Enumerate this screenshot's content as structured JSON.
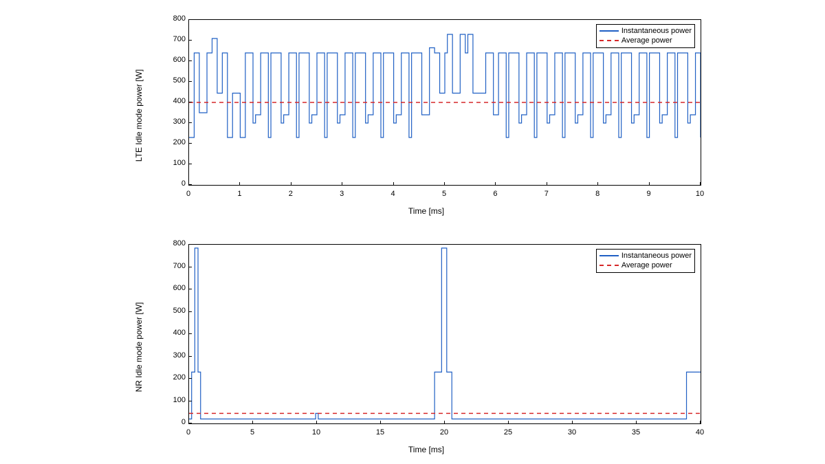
{
  "chart_data": [
    {
      "type": "line",
      "title": "",
      "xlabel": "Time [ms]",
      "ylabel": "LTE Idle mode power [W]",
      "xlim": [
        0,
        10
      ],
      "ylim": [
        0,
        800
      ],
      "xticks": [
        0,
        1,
        2,
        3,
        4,
        5,
        6,
        7,
        8,
        9,
        10
      ],
      "yticks": [
        0,
        100,
        200,
        300,
        400,
        500,
        600,
        700,
        800
      ],
      "legend": {
        "position": "upper-right",
        "entries": [
          "Instantaneous power",
          "Average power"
        ]
      },
      "average": 400,
      "note": "Instantaneous power toggles between ~230 W (low) and ~640 W (high) on ~0.25 ms slots; sporadic peaks ~710–730 W and mid-level ~445 W segments.",
      "series": [
        {
          "name": "Instantaneous power",
          "kind": "step",
          "segments_x_y": [
            [
              0.0,
              230
            ],
            [
              0.1,
              230
            ],
            [
              0.1,
              640
            ],
            [
              0.2,
              640
            ],
            [
              0.2,
              350
            ],
            [
              0.35,
              350
            ],
            [
              0.35,
              640
            ],
            [
              0.45,
              640
            ],
            [
              0.45,
              710
            ],
            [
              0.55,
              710
            ],
            [
              0.55,
              445
            ],
            [
              0.65,
              445
            ],
            [
              0.65,
              640
            ],
            [
              0.75,
              640
            ],
            [
              0.75,
              230
            ],
            [
              0.85,
              230
            ],
            [
              0.85,
              445
            ],
            [
              1.0,
              445
            ],
            [
              1.0,
              230
            ],
            [
              1.1,
              230
            ],
            [
              1.1,
              640
            ],
            [
              1.25,
              640
            ],
            [
              1.25,
              300
            ],
            [
              1.3,
              300
            ],
            [
              1.3,
              340
            ],
            [
              1.4,
              340
            ],
            [
              1.4,
              640
            ],
            [
              1.55,
              640
            ],
            [
              1.55,
              230
            ],
            [
              1.6,
              230
            ],
            [
              1.6,
              640
            ],
            [
              1.8,
              640
            ],
            [
              1.8,
              300
            ],
            [
              1.85,
              300
            ],
            [
              1.85,
              340
            ],
            [
              1.95,
              340
            ],
            [
              1.95,
              640
            ],
            [
              2.1,
              640
            ],
            [
              2.1,
              230
            ],
            [
              2.15,
              230
            ],
            [
              2.15,
              640
            ],
            [
              2.35,
              640
            ],
            [
              2.35,
              300
            ],
            [
              2.4,
              300
            ],
            [
              2.4,
              340
            ],
            [
              2.5,
              340
            ],
            [
              2.5,
              640
            ],
            [
              2.65,
              640
            ],
            [
              2.65,
              230
            ],
            [
              2.7,
              230
            ],
            [
              2.7,
              640
            ],
            [
              2.9,
              640
            ],
            [
              2.9,
              300
            ],
            [
              2.95,
              300
            ],
            [
              2.95,
              340
            ],
            [
              3.05,
              340
            ],
            [
              3.05,
              640
            ],
            [
              3.2,
              640
            ],
            [
              3.2,
              230
            ],
            [
              3.25,
              230
            ],
            [
              3.25,
              640
            ],
            [
              3.45,
              640
            ],
            [
              3.45,
              300
            ],
            [
              3.5,
              300
            ],
            [
              3.5,
              340
            ],
            [
              3.6,
              340
            ],
            [
              3.6,
              640
            ],
            [
              3.75,
              640
            ],
            [
              3.75,
              230
            ],
            [
              3.8,
              230
            ],
            [
              3.8,
              640
            ],
            [
              4.0,
              640
            ],
            [
              4.0,
              300
            ],
            [
              4.05,
              300
            ],
            [
              4.05,
              340
            ],
            [
              4.15,
              340
            ],
            [
              4.15,
              640
            ],
            [
              4.3,
              640
            ],
            [
              4.3,
              230
            ],
            [
              4.35,
              230
            ],
            [
              4.35,
              640
            ],
            [
              4.55,
              640
            ],
            [
              4.55,
              340
            ],
            [
              4.7,
              340
            ],
            [
              4.7,
              665
            ],
            [
              4.8,
              665
            ],
            [
              4.8,
              640
            ],
            [
              4.9,
              640
            ],
            [
              4.9,
              445
            ],
            [
              5.0,
              445
            ],
            [
              5.0,
              640
            ],
            [
              5.05,
              640
            ],
            [
              5.05,
              730
            ],
            [
              5.15,
              730
            ],
            [
              5.15,
              445
            ],
            [
              5.3,
              445
            ],
            [
              5.3,
              730
            ],
            [
              5.4,
              730
            ],
            [
              5.4,
              640
            ],
            [
              5.45,
              640
            ],
            [
              5.45,
              730
            ],
            [
              5.55,
              730
            ],
            [
              5.55,
              445
            ],
            [
              5.8,
              445
            ],
            [
              5.8,
              640
            ],
            [
              5.95,
              640
            ],
            [
              5.95,
              340
            ],
            [
              6.05,
              340
            ],
            [
              6.05,
              640
            ],
            [
              6.2,
              640
            ],
            [
              6.2,
              230
            ],
            [
              6.25,
              230
            ],
            [
              6.25,
              640
            ],
            [
              6.45,
              640
            ],
            [
              6.45,
              300
            ],
            [
              6.5,
              300
            ],
            [
              6.5,
              340
            ],
            [
              6.6,
              340
            ],
            [
              6.6,
              640
            ],
            [
              6.75,
              640
            ],
            [
              6.75,
              230
            ],
            [
              6.8,
              230
            ],
            [
              6.8,
              640
            ],
            [
              7.0,
              640
            ],
            [
              7.0,
              300
            ],
            [
              7.05,
              300
            ],
            [
              7.05,
              340
            ],
            [
              7.15,
              340
            ],
            [
              7.15,
              640
            ],
            [
              7.3,
              640
            ],
            [
              7.3,
              230
            ],
            [
              7.35,
              230
            ],
            [
              7.35,
              640
            ],
            [
              7.55,
              640
            ],
            [
              7.55,
              300
            ],
            [
              7.6,
              300
            ],
            [
              7.6,
              340
            ],
            [
              7.7,
              340
            ],
            [
              7.7,
              640
            ],
            [
              7.85,
              640
            ],
            [
              7.85,
              230
            ],
            [
              7.9,
              230
            ],
            [
              7.9,
              640
            ],
            [
              8.1,
              640
            ],
            [
              8.1,
              300
            ],
            [
              8.15,
              300
            ],
            [
              8.15,
              340
            ],
            [
              8.25,
              340
            ],
            [
              8.25,
              640
            ],
            [
              8.4,
              640
            ],
            [
              8.4,
              230
            ],
            [
              8.45,
              230
            ],
            [
              8.45,
              640
            ],
            [
              8.65,
              640
            ],
            [
              8.65,
              300
            ],
            [
              8.7,
              300
            ],
            [
              8.7,
              340
            ],
            [
              8.8,
              340
            ],
            [
              8.8,
              640
            ],
            [
              8.95,
              640
            ],
            [
              8.95,
              230
            ],
            [
              9.0,
              230
            ],
            [
              9.0,
              640
            ],
            [
              9.2,
              640
            ],
            [
              9.2,
              300
            ],
            [
              9.25,
              300
            ],
            [
              9.25,
              340
            ],
            [
              9.35,
              340
            ],
            [
              9.35,
              640
            ],
            [
              9.5,
              640
            ],
            [
              9.5,
              230
            ],
            [
              9.55,
              230
            ],
            [
              9.55,
              640
            ],
            [
              9.75,
              640
            ],
            [
              9.75,
              300
            ],
            [
              9.8,
              300
            ],
            [
              9.8,
              340
            ],
            [
              9.9,
              340
            ],
            [
              9.9,
              640
            ],
            [
              10.0,
              640
            ],
            [
              10.0,
              230
            ]
          ]
        },
        {
          "name": "Average power",
          "kind": "hline",
          "y": 400
        }
      ]
    },
    {
      "type": "line",
      "title": "",
      "xlabel": "Time [ms]",
      "ylabel": "NR Idle mode power [W]",
      "xlim": [
        0,
        40
      ],
      "ylim": [
        0,
        800
      ],
      "xticks": [
        0,
        5,
        10,
        15,
        20,
        25,
        30,
        35,
        40
      ],
      "yticks": [
        0,
        100,
        200,
        300,
        400,
        500,
        600,
        700,
        800
      ],
      "legend": {
        "position": "upper-right",
        "entries": [
          "Instantaneous power",
          "Average power"
        ]
      },
      "average": 45,
      "note": "Baseline ~20 W with brief ~230 W plateaus and ~785 W spikes near 0.5 ms and 20 ms; rises to ~230 W near 39–40 ms.",
      "series": [
        {
          "name": "Instantaneous power",
          "kind": "step",
          "segments_x_y": [
            [
              0.0,
              20
            ],
            [
              0.2,
              20
            ],
            [
              0.2,
              230
            ],
            [
              0.45,
              230
            ],
            [
              0.45,
              785
            ],
            [
              0.7,
              785
            ],
            [
              0.7,
              230
            ],
            [
              0.9,
              230
            ],
            [
              0.9,
              20
            ],
            [
              9.9,
              20
            ],
            [
              9.9,
              45
            ],
            [
              10.1,
              45
            ],
            [
              10.1,
              20
            ],
            [
              19.2,
              20
            ],
            [
              19.2,
              230
            ],
            [
              19.75,
              230
            ],
            [
              19.75,
              785
            ],
            [
              20.15,
              785
            ],
            [
              20.15,
              230
            ],
            [
              20.55,
              230
            ],
            [
              20.55,
              20
            ],
            [
              38.9,
              20
            ],
            [
              38.9,
              230
            ],
            [
              40.0,
              230
            ]
          ]
        },
        {
          "name": "Average power",
          "kind": "hline",
          "y": 45
        }
      ]
    }
  ],
  "legend_labels": {
    "instantaneous": "Instantaneous power",
    "average": "Average power"
  }
}
